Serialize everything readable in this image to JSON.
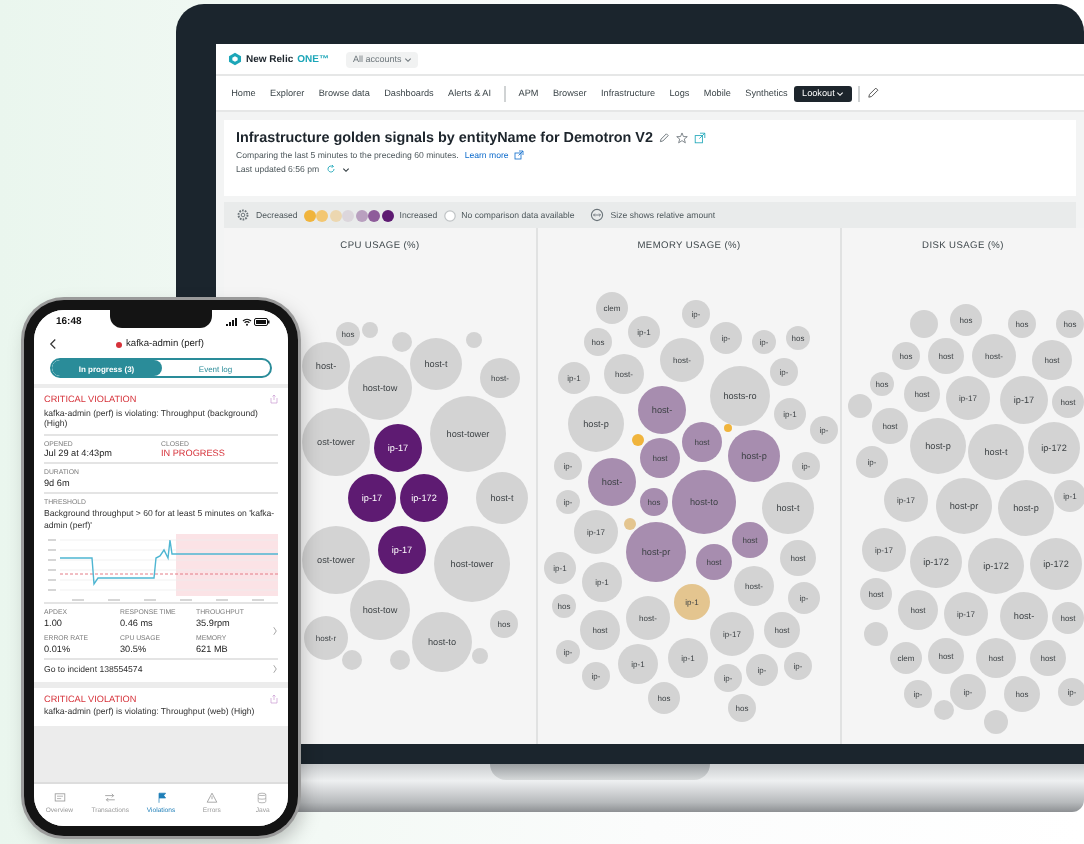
{
  "laptop": {
    "logo": {
      "name": "New Relic",
      "product": "ONE™"
    },
    "account_menu": "All accounts",
    "nav": [
      [
        {
          "label": "Home",
          "selected": false
        },
        {
          "label": "Explorer",
          "selected": false
        },
        {
          "label": "Browse data",
          "selected": false
        },
        {
          "label": "Dashboards",
          "selected": false
        },
        {
          "label": "Alerts & AI",
          "selected": false
        }
      ],
      [
        {
          "label": "APM",
          "selected": false
        },
        {
          "label": "Browser",
          "selected": false
        },
        {
          "label": "Infrastructure",
          "selected": false
        },
        {
          "label": "Logs",
          "selected": false
        },
        {
          "label": "Mobile",
          "selected": false
        },
        {
          "label": "Synthetics",
          "selected": false
        },
        {
          "label": "Lookout",
          "selected": true
        }
      ]
    ],
    "title": "Infrastructure golden signals by entityName for Demotron V2",
    "subtitle": "Comparing the last 5 minutes to the preceding 60 minutes.",
    "learn_more": "Learn more",
    "updated": "Last updated 6:56 pm",
    "legend": {
      "decreased": "Decreased",
      "scale": [
        {
          "color": "#f0b43c"
        },
        {
          "color": "#f3c772"
        },
        {
          "color": "#ecd7b0"
        },
        {
          "color": "#dcd6dc"
        },
        {
          "color": "#b9a0bf"
        },
        {
          "color": "#8e5c9a"
        },
        {
          "color": "#5e1b72"
        }
      ],
      "increased": "Increased",
      "no_data": "No comparison data available",
      "size_note": "Size shows relative amount"
    },
    "panels": [
      {
        "title": "CPU USAGE (%)",
        "bubbles": [
          {
            "label": "host-",
            "color": "#d3d3d3"
          },
          {
            "label": "hos",
            "color": "#d3d3d3"
          },
          {
            "label": "host-tow",
            "color": "#d3d3d3"
          },
          {
            "label": "host-t",
            "color": "#d3d3d3"
          },
          {
            "label": "host-",
            "color": "#d3d3d3"
          },
          {
            "label": "ost-tower",
            "color": "#d3d3d3"
          },
          {
            "label": "ip-17",
            "color": "#5e1b72"
          },
          {
            "label": "host-tower",
            "color": "#d3d3d3"
          },
          {
            "label": "ip-17",
            "color": "#5e1b72"
          },
          {
            "label": "ip-172",
            "color": "#5e1b72"
          },
          {
            "label": "host-t",
            "color": "#d3d3d3"
          },
          {
            "label": "ost-tower",
            "color": "#d3d3d3"
          },
          {
            "label": "ip-17",
            "color": "#5e1b72"
          },
          {
            "label": "host-tower",
            "color": "#d3d3d3"
          },
          {
            "label": "host-tow",
            "color": "#d3d3d3"
          },
          {
            "label": "host-r",
            "color": "#d3d3d3"
          },
          {
            "label": "host-to",
            "color": "#d3d3d3"
          },
          {
            "label": "hos",
            "color": "#d3d3d3"
          },
          {
            "color": "#d3d3d3"
          },
          {
            "color": "#d3d3d3"
          },
          {
            "color": "#d3d3d3"
          },
          {
            "color": "#d3d3d3"
          },
          {
            "color": "#d3d3d3"
          },
          {
            "color": "#d3d3d3"
          }
        ]
      },
      {
        "title": "MEMORY USAGE (%)",
        "bubbles": [
          {
            "label": "clem",
            "color": "#d3d3d3"
          },
          {
            "label": "ip-",
            "color": "#d3d3d3"
          },
          {
            "label": "ip-1",
            "color": "#d3d3d3"
          },
          {
            "label": "hos",
            "color": "#d3d3d3"
          },
          {
            "label": "ip-",
            "color": "#d3d3d3"
          },
          {
            "label": "ip-",
            "color": "#d3d3d3"
          },
          {
            "label": "hos",
            "color": "#d3d3d3"
          },
          {
            "label": "host-",
            "color": "#d3d3d3"
          },
          {
            "label": "ip-1",
            "color": "#d3d3d3"
          },
          {
            "label": "host-",
            "color": "#d3d3d3"
          },
          {
            "label": "ip-",
            "color": "#d3d3d3"
          },
          {
            "label": "host-p",
            "color": "#d3d3d3"
          },
          {
            "label": "host-",
            "color": "#a78daf"
          },
          {
            "label": "hosts-ro",
            "color": "#d3d3d3"
          },
          {
            "label": "ip-1",
            "color": "#d3d3d3"
          },
          {
            "label": "ip-",
            "color": "#d3d3d3"
          },
          {
            "label": "host",
            "color": "#a78daf"
          },
          {
            "label": "host-p",
            "color": "#a78daf"
          },
          {
            "label": "host",
            "color": "#a78daf"
          },
          {
            "label": "ip-",
            "color": "#d3d3d3"
          },
          {
            "label": "ip-",
            "color": "#d3d3d3"
          },
          {
            "label": "host-",
            "color": "#a78daf"
          },
          {
            "label": "ip-",
            "color": "#d3d3d3"
          },
          {
            "label": "hos",
            "color": "#a78daf"
          },
          {
            "label": "host-to",
            "color": "#a78daf"
          },
          {
            "label": "host-t",
            "color": "#d3d3d3"
          },
          {
            "label": "ip-17",
            "color": "#d3d3d3"
          },
          {
            "label": "host",
            "color": "#a78daf"
          },
          {
            "label": "host-pr",
            "color": "#a78daf"
          },
          {
            "label": "host",
            "color": "#a78daf"
          },
          {
            "label": "host",
            "color": "#d3d3d3"
          },
          {
            "label": "ip-1",
            "color": "#d3d3d3"
          },
          {
            "label": "host-",
            "color": "#d3d3d3"
          },
          {
            "label": "ip-1",
            "color": "#d3d3d3"
          },
          {
            "label": "ip-1",
            "color": "#e4c58f"
          },
          {
            "label": "ip-",
            "color": "#d3d3d3"
          },
          {
            "label": "hos",
            "color": "#d3d3d3"
          },
          {
            "label": "host-",
            "color": "#d3d3d3"
          },
          {
            "label": "ip-17",
            "color": "#d3d3d3"
          },
          {
            "label": "host",
            "color": "#d3d3d3"
          },
          {
            "label": "host",
            "color": "#d3d3d3"
          },
          {
            "label": "ip-",
            "color": "#d3d3d3"
          },
          {
            "label": "ip-1",
            "color": "#d3d3d3"
          },
          {
            "label": "ip-1",
            "color": "#d3d3d3"
          },
          {
            "label": "ip-",
            "color": "#d3d3d3"
          },
          {
            "label": "ip-",
            "color": "#d3d3d3"
          },
          {
            "label": "ip-",
            "color": "#d3d3d3"
          },
          {
            "label": "ip-",
            "color": "#d3d3d3"
          },
          {
            "label": "hos",
            "color": "#d3d3d3"
          },
          {
            "label": "hos",
            "color": "#d3d3d3"
          },
          {
            "color": "#e4c58f"
          },
          {
            "color": "#f0b43c"
          },
          {
            "color": "#f0b43c"
          }
        ]
      },
      {
        "title": "DISK USAGE (%)",
        "bubbles": [
          {
            "color": "#d3d3d3"
          },
          {
            "label": "hos",
            "color": "#d3d3d3"
          },
          {
            "label": "hos",
            "color": "#d3d3d3"
          },
          {
            "label": "hos",
            "color": "#d3d3d3"
          },
          {
            "label": "hos",
            "color": "#d3d3d3"
          },
          {
            "label": "host",
            "color": "#d3d3d3"
          },
          {
            "label": "host-",
            "color": "#d3d3d3"
          },
          {
            "label": "host",
            "color": "#d3d3d3"
          },
          {
            "label": "hos",
            "color": "#d3d3d3"
          },
          {
            "label": "host",
            "color": "#d3d3d3"
          },
          {
            "label": "ip-17",
            "color": "#d3d3d3"
          },
          {
            "label": "ip-17",
            "color": "#d3d3d3"
          },
          {
            "label": "host",
            "color": "#d3d3d3"
          },
          {
            "color": "#d3d3d3"
          },
          {
            "label": "host",
            "color": "#d3d3d3"
          },
          {
            "label": "host-p",
            "color": "#d3d3d3"
          },
          {
            "label": "host-t",
            "color": "#d3d3d3"
          },
          {
            "label": "ip-172",
            "color": "#d3d3d3"
          },
          {
            "label": "ip-",
            "color": "#d3d3d3"
          },
          {
            "label": "ip-17",
            "color": "#d3d3d3"
          },
          {
            "label": "host-pr",
            "color": "#d3d3d3"
          },
          {
            "label": "host-p",
            "color": "#d3d3d3"
          },
          {
            "label": "ip-1",
            "color": "#d3d3d3"
          },
          {
            "label": "ip-17",
            "color": "#d3d3d3"
          },
          {
            "label": "ip-172",
            "color": "#d3d3d3"
          },
          {
            "label": "ip-172",
            "color": "#d3d3d3"
          },
          {
            "label": "ip-172",
            "color": "#d3d3d3"
          },
          {
            "label": "host",
            "color": "#d3d3d3"
          },
          {
            "label": "host",
            "color": "#d3d3d3"
          },
          {
            "label": "ip-17",
            "color": "#d3d3d3"
          },
          {
            "label": "host-",
            "color": "#d3d3d3"
          },
          {
            "label": "host",
            "color": "#d3d3d3"
          },
          {
            "color": "#d3d3d3"
          },
          {
            "label": "clem",
            "color": "#d3d3d3"
          },
          {
            "label": "host",
            "color": "#d3d3d3"
          },
          {
            "label": "host",
            "color": "#d3d3d3"
          },
          {
            "label": "host",
            "color": "#d3d3d3"
          },
          {
            "label": "ip-",
            "color": "#d3d3d3"
          },
          {
            "label": "ip-",
            "color": "#d3d3d3"
          },
          {
            "label": "hos",
            "color": "#d3d3d3"
          },
          {
            "label": "ip-",
            "color": "#d3d3d3"
          },
          {
            "color": "#d3d3d3"
          },
          {
            "color": "#d3d3d3"
          }
        ]
      }
    ]
  },
  "phone": {
    "time": "16:48",
    "title": "kafka-admin (perf)",
    "tabs": [
      {
        "label": "In progress (3)",
        "selected": true
      },
      {
        "label": "Event log",
        "selected": false
      }
    ],
    "violation": {
      "heading": "CRITICAL VIOLATION",
      "message": "kafka-admin (perf) is violating: Throughput (background) (High)",
      "fields": [
        {
          "label": "OPENED",
          "value": "Jul 29 at 4:43pm",
          "alert": false
        },
        {
          "label": "CLOSED",
          "value": "IN PROGRESS",
          "alert": true
        }
      ],
      "duration": {
        "label": "DURATION",
        "value": "9d 6m"
      },
      "threshold": {
        "label": "THRESHOLD",
        "value": "Background throughput > 60 for at least 5 minutes on 'kafka-admin (perf)'"
      },
      "metrics": [
        {
          "label": "APDEX",
          "value": "1.00"
        },
        {
          "label": "RESPONSE TIME",
          "value": "0.46 ms"
        },
        {
          "label": "THROUGHPUT",
          "value": "35.9rpm"
        },
        {
          "label": "ERROR RATE",
          "value": "0.01%"
        },
        {
          "label": "CPU USAGE",
          "value": "30.5%"
        },
        {
          "label": "MEMORY",
          "value": "621 MB"
        }
      ],
      "incident_link": "Go to incident 138554574"
    },
    "next_violation": {
      "heading": "CRITICAL VIOLATION",
      "message": "kafka-admin (perf) is violating: Throughput (web) (High)"
    },
    "bottom_tabs": [
      {
        "label": "Overview",
        "selected": false
      },
      {
        "label": "Transactions",
        "selected": false
      },
      {
        "label": "Violations",
        "selected": true
      },
      {
        "label": "Errors",
        "selected": false
      },
      {
        "label": "Java",
        "selected": false
      }
    ]
  }
}
